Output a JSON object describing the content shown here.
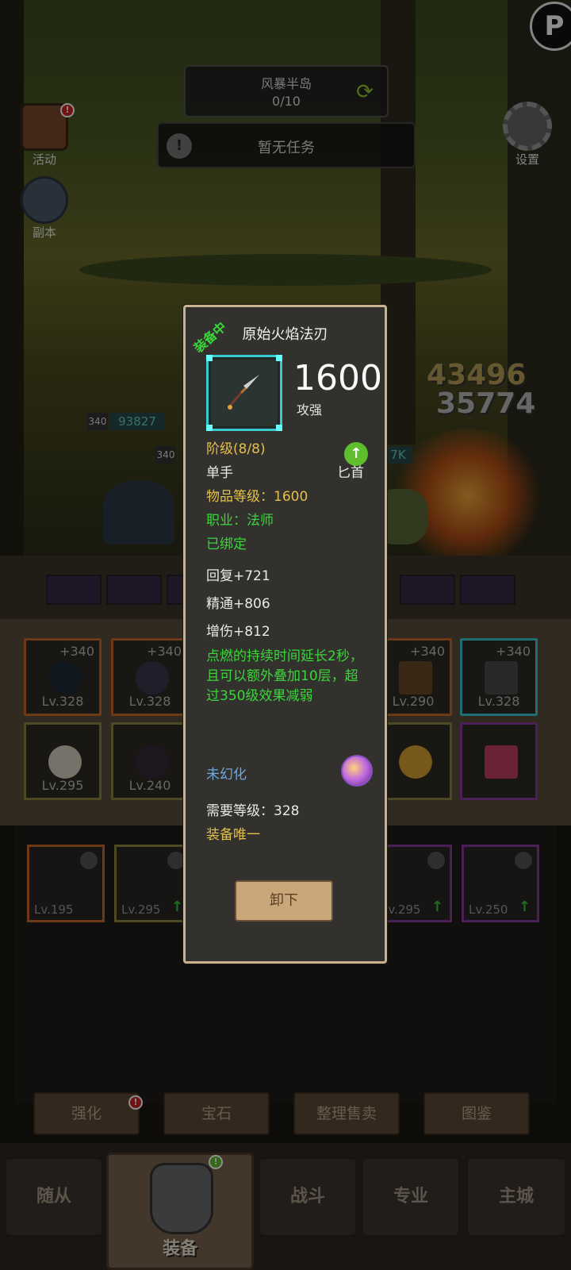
{
  "hud": {
    "zone_name": "风暴半岛",
    "zone_progress": "0/10",
    "task_text": "暂无任务",
    "activity_label": "活动",
    "dungeon_label": "副本",
    "settings_label": "设置",
    "damage_numbers": [
      "43496",
      "35774"
    ],
    "enemy_level_1": "340",
    "enemy_hp_1": "93827",
    "enemy_level_2": "340",
    "enemy_hp_2": "7K"
  },
  "equipment_slots": [
    {
      "plus": "+340",
      "level": "Lv.328",
      "color": "#c8682a"
    },
    {
      "plus": "+340",
      "level": "Lv.328",
      "color": "#c8682a"
    },
    {
      "plus": "+340",
      "level": "Lv.290",
      "color": "#c8682a"
    },
    {
      "plus": "+340",
      "level": "Lv.328",
      "color": "#39c9d0"
    },
    {
      "plus": "",
      "level": "Lv.295",
      "color": "#8a8640"
    },
    {
      "plus": "",
      "level": "Lv.240",
      "color": "#8a8640"
    },
    {
      "plus": "",
      "level": "",
      "color": "#8a8640"
    },
    {
      "plus": "",
      "level": "",
      "color": "#8a3aa0"
    }
  ],
  "bag_slots": [
    {
      "level": "Lv.195",
      "color": "#c8682a",
      "upgrade": false
    },
    {
      "level": "Lv.295",
      "color": "#8a8640",
      "upgrade": true
    },
    {
      "level": "Lv.295",
      "color": "#8a3aa0",
      "upgrade": true
    },
    {
      "level": "Lv.250",
      "color": "#8a3aa0",
      "upgrade": true
    }
  ],
  "action_tabs": [
    "强化",
    "宝石",
    "整理售卖",
    "图鉴"
  ],
  "nav": {
    "companion": "随从",
    "equipment": "装备",
    "battle": "战斗",
    "profession": "专业",
    "main_city": "主城"
  },
  "item": {
    "equipped_tag": "装备中",
    "name": "原始火焰法刃",
    "power": "1600",
    "power_label": "攻强",
    "tier": "阶级(8/8)",
    "hand": "单手",
    "weapon_type": "匕首",
    "item_level": "物品等级：1600",
    "class": "职业：法师",
    "bound": "已绑定",
    "stats": [
      "回复+721",
      "精通+806",
      "增伤+812"
    ],
    "effect": "点燃的持续时间延长2秒，且可以额外叠加10层，超过350级效果减弱",
    "transmog": "未幻化",
    "required_level": "需要等级：328",
    "unique": "装备唯一",
    "unequip_button": "卸下"
  }
}
